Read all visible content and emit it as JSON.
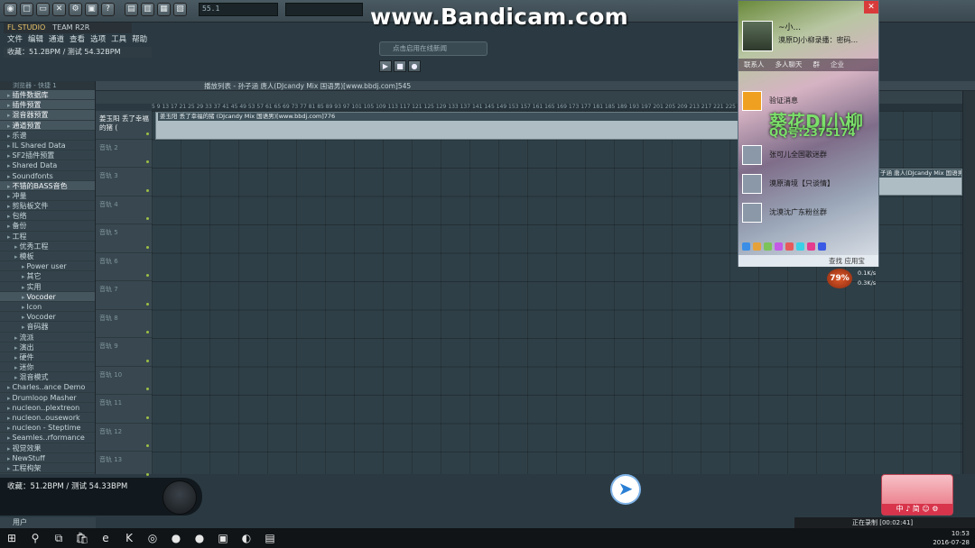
{
  "watermark": "www.Bandicam.com",
  "app": {
    "logo": "FL STUDIO",
    "team": "TEAM R2R",
    "menu": [
      "文件",
      "编辑",
      "通道",
      "查看",
      "选项",
      "工具",
      "帮助"
    ],
    "status_top": "收藏：51.2BPM / 测试 54.32BPM",
    "hint_bubble": "点击启用在线新闻",
    "lcd_top": "55.1"
  },
  "browser": {
    "header": "浏览器 - 快捷 1",
    "items": [
      {
        "label": "插件数据库",
        "hl": true
      },
      {
        "label": "插件预置",
        "hl": true
      },
      {
        "label": "混音器预置",
        "hl": true
      },
      {
        "label": "通道预置",
        "hl": true
      },
      {
        "label": "乐谱",
        "hl": false
      },
      {
        "label": "IL Shared Data",
        "hl": false
      },
      {
        "label": "SF2插件预置",
        "hl": false
      },
      {
        "label": "Shared Data",
        "hl": false
      },
      {
        "label": "Soundfonts",
        "hl": false
      },
      {
        "label": "不错的BASS音色",
        "hl": true
      },
      {
        "label": "冲量",
        "hl": false
      },
      {
        "label": "剪贴板文件",
        "hl": false
      },
      {
        "label": "包络",
        "hl": false
      },
      {
        "label": "备份",
        "hl": false
      },
      {
        "label": "工程",
        "hl": false
      },
      {
        "label": "优秀工程",
        "hl": false
      },
      {
        "label": "模板",
        "hl": false
      },
      {
        "label": "Power user",
        "hl": false
      },
      {
        "label": "其它",
        "hl": false
      },
      {
        "label": "实用",
        "hl": false
      },
      {
        "label": "Vocoder",
        "hl": true
      },
      {
        "label": "Icon",
        "hl": false
      },
      {
        "label": "Vocoder",
        "hl": false
      },
      {
        "label": "音码器",
        "hl": false
      },
      {
        "label": "流派",
        "hl": false
      },
      {
        "label": "演出",
        "hl": false
      },
      {
        "label": "硬件",
        "hl": false
      },
      {
        "label": "迷你",
        "hl": false
      },
      {
        "label": "混音模式",
        "hl": false
      },
      {
        "label": "Charles..ance Demo",
        "hl": false
      },
      {
        "label": "Drumloop Masher",
        "hl": false
      },
      {
        "label": "nucleon..plextreon",
        "hl": false
      },
      {
        "label": "nucleon..ousework",
        "hl": false
      },
      {
        "label": "nucleon - Steptime",
        "hl": false
      },
      {
        "label": "Seamles..rformance",
        "hl": false
      },
      {
        "label": "视觉效果",
        "hl": false
      },
      {
        "label": "NewStuff",
        "hl": false
      },
      {
        "label": "工程构架",
        "hl": false
      }
    ],
    "user": "用户"
  },
  "playlist": {
    "title": "播放列表 - 孙子涵 唐人(DJcandy Mix 国语男)[www.bbdj.com]545",
    "ruler": "5  9  13  17  21  25  29  33  37  41  45  49  53  57  61  65  69  73  77  81  85  89  93  97  101  105  109  113  117  121  125  129  133  137  141  145  149  153  157  161  165  169  173  177  181  185  189  193  197  201  205  209  213  217  221  225",
    "first_track": "姜玉阳 丢了幸福的猪 (",
    "tracks": [
      "音轨 2",
      "音轨 3",
      "音轨 4",
      "音轨 5",
      "音轨 6",
      "音轨 7",
      "音轨 8",
      "音轨 9",
      "音轨 10",
      "音轨 11",
      "音轨 12",
      "音轨 13"
    ],
    "clip1": "姜玉阳 丢了幸福的猪 (DJcandy Mix 国语男)[www.bbdj.com]776",
    "clip2": "子涵 唐人(DJcandy Mix 国语男"
  },
  "bottom_status": "收藏：51.2BPM / 测试 54.33BPM",
  "qq": {
    "name": "~小...",
    "sign": "漠原DJ小柳录播：密码...",
    "tabs": [
      "联系人",
      "多人聊天",
      "群",
      "企业"
    ],
    "verify": "验证消息",
    "big_text": "葵花DJ小柳",
    "number": "QQ号:2375174",
    "contacts": [
      "张可儿全国歌迷群",
      "漠原清境【只谈情】",
      "沈漠沈广东粉丝群"
    ],
    "footer": "查找  应用宝"
  },
  "netmon": {
    "percent": "79%",
    "up": "0.1K/s",
    "down": "0.3K/s"
  },
  "ime": "中 ♪ 简 ☺ ⚙",
  "record_status": "正在录制 [00:02:41]",
  "clock": {
    "time": "10:53",
    "date": "2016-07-28"
  },
  "taskbar": [
    "⊞",
    "⚲",
    "⧉",
    "🛍",
    "e",
    "K",
    "◎",
    "●",
    "●",
    "▣",
    "◐",
    "▤"
  ]
}
